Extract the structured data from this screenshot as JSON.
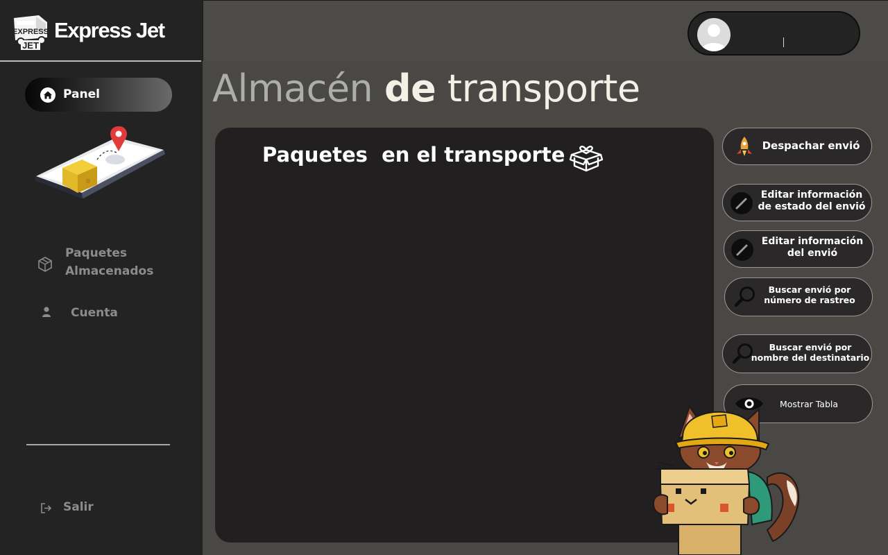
{
  "brand": {
    "name": "Express Jet",
    "logo_top": "EXPRESS",
    "logo_bottom": "JET"
  },
  "sidebar": {
    "panel_label": "Panel",
    "items": [
      {
        "line1": "Paquetes",
        "line2": "Almacenados",
        "icon": "box-icon"
      },
      {
        "label": "Cuenta",
        "icon": "user-icon"
      }
    ],
    "logout_label": "Salir"
  },
  "header": {
    "user_name": ""
  },
  "title": {
    "word1": "Almacén",
    "word2": "de",
    "word3": "transporte"
  },
  "panel": {
    "title": "Paquetes  en el transporte"
  },
  "actions": {
    "dispatch": "Despachar  envió",
    "edit_status_l1": "Editar información",
    "edit_status_l2": "de estado del envió",
    "edit_info_l1": "Editar información",
    "edit_info_l2": "del  envió",
    "search_tracking_l1": "Buscar  envió por",
    "search_tracking_l2": "número de rastreo",
    "search_name_l1": "Buscar  envió por",
    "search_name_l2": "nombre del destinatario",
    "show_table": "Mostrar Tabla"
  },
  "colors": {
    "sidebar": "#232323",
    "background": "#4a4845",
    "panel": "#221f20",
    "title_light": "#f3f0e6",
    "title_muted": "#adadad"
  }
}
